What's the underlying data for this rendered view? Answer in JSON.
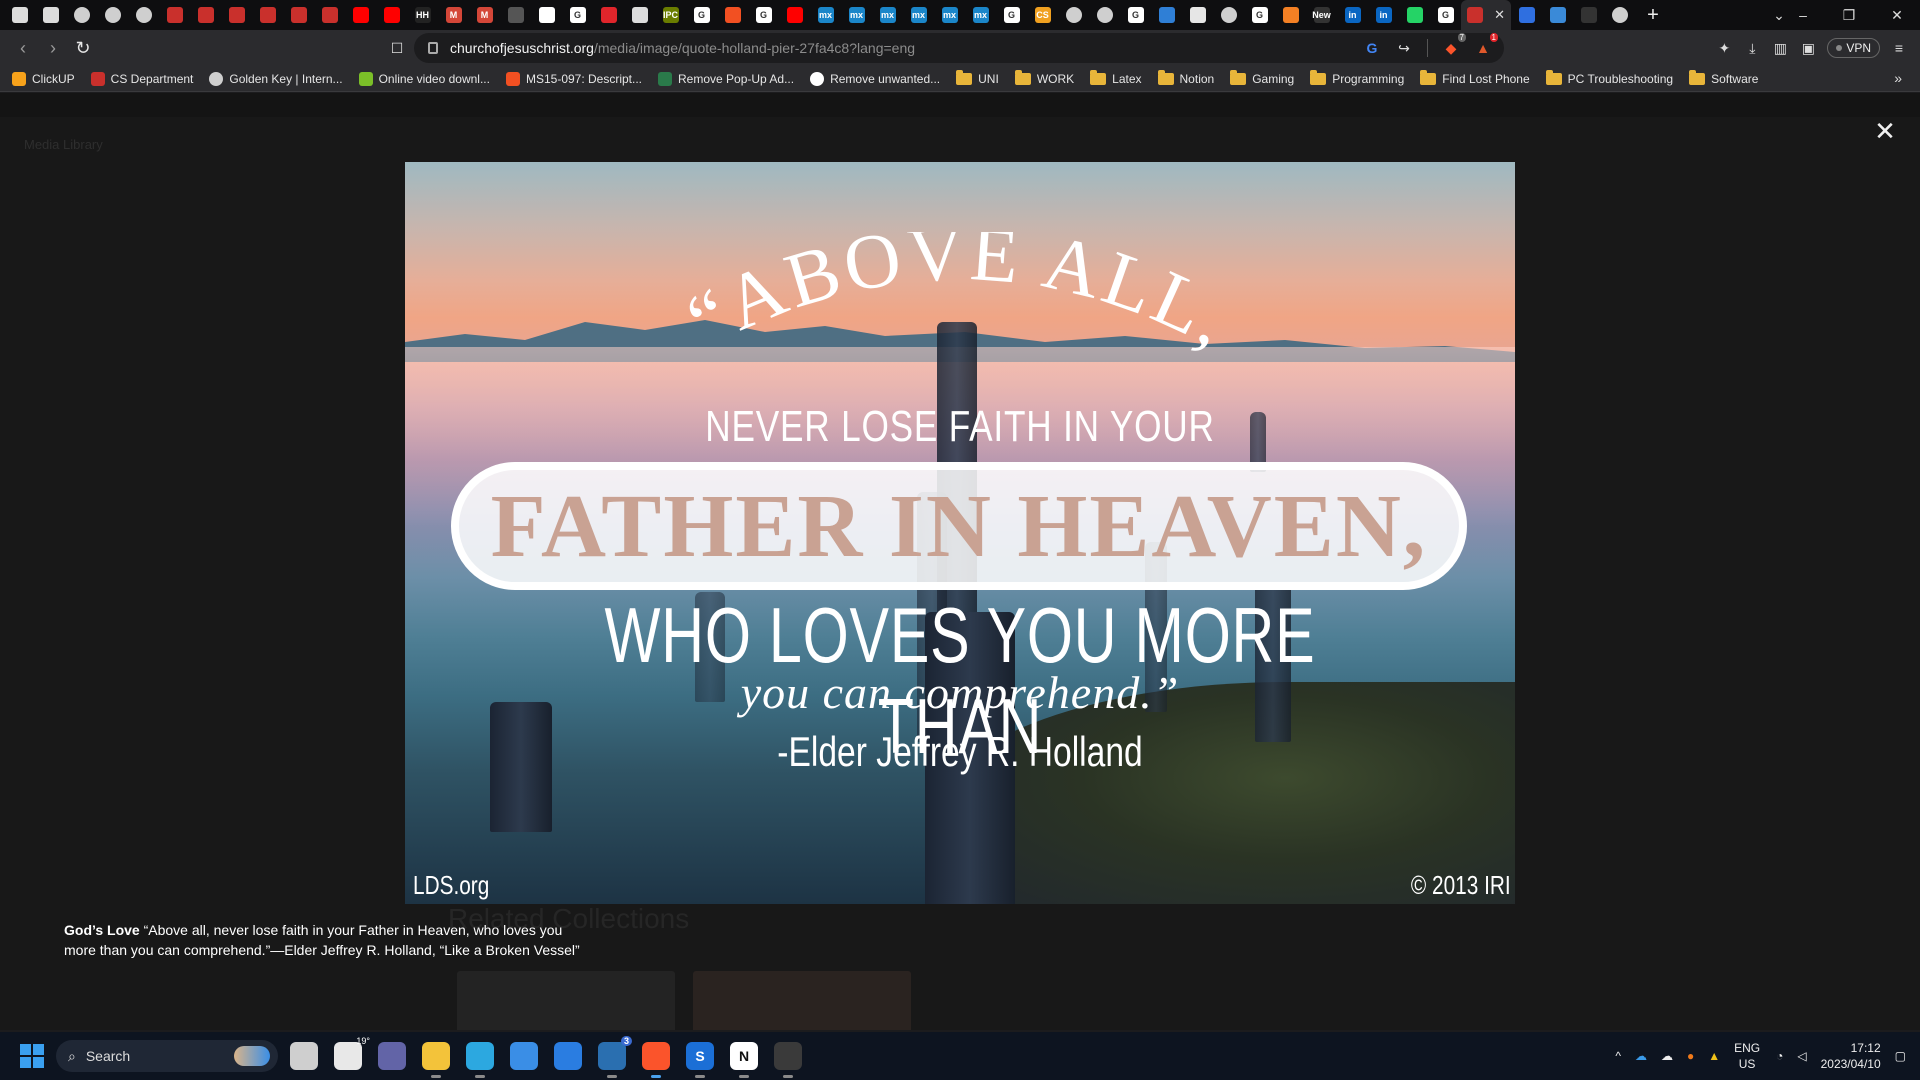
{
  "browser": {
    "tabs": [
      {
        "icon": "page-icon",
        "color": "#dcdcdc"
      },
      {
        "icon": "page-icon",
        "color": "#dcdcdc"
      },
      {
        "icon": "globe-icon",
        "color": "#cfcfcf"
      },
      {
        "icon": "globe-icon",
        "color": "#cfcfcf"
      },
      {
        "icon": "globe-icon",
        "color": "#cfcfcf"
      },
      {
        "icon": "church-icon",
        "color": "#c9302c"
      },
      {
        "icon": "church-icon",
        "color": "#c9302c"
      },
      {
        "icon": "church-icon",
        "color": "#c9302c"
      },
      {
        "icon": "church-icon",
        "color": "#c9302c"
      },
      {
        "icon": "church-icon",
        "color": "#c9302c"
      },
      {
        "icon": "church-icon",
        "color": "#c9302c"
      },
      {
        "icon": "youtube-icon",
        "color": "#ff0000"
      },
      {
        "icon": "youtube-icon",
        "color": "#ff0000"
      },
      {
        "icon": "hh-icon",
        "color": "#222222",
        "label": "HH"
      },
      {
        "icon": "gmail-icon",
        "color": "#d44638",
        "label": "M"
      },
      {
        "icon": "gmail-icon",
        "color": "#d44638",
        "label": "M"
      },
      {
        "icon": "heart-icon",
        "color": "#555555"
      },
      {
        "icon": "flag-icon",
        "color": "#ffffff"
      },
      {
        "icon": "google-icon",
        "color": "#ffffff",
        "label": "G"
      },
      {
        "icon": "red-icon",
        "color": "#e0252b"
      },
      {
        "icon": "download-icon",
        "color": "#dddddd"
      },
      {
        "icon": "ipc-icon",
        "color": "#6a7d00",
        "label": "IPC"
      },
      {
        "icon": "google-icon",
        "color": "#ffffff",
        "label": "G"
      },
      {
        "icon": "microsoft-icon",
        "color": "#f25022"
      },
      {
        "icon": "google-icon",
        "color": "#ffffff",
        "label": "G"
      },
      {
        "icon": "youtube-icon",
        "color": "#ff0000"
      },
      {
        "icon": "mx-icon",
        "color": "#1b86c9",
        "label": "mx"
      },
      {
        "icon": "mx-icon",
        "color": "#1b86c9",
        "label": "mx"
      },
      {
        "icon": "mx-icon",
        "color": "#1b86c9",
        "label": "mx"
      },
      {
        "icon": "mx-icon",
        "color": "#1b86c9",
        "label": "mx"
      },
      {
        "icon": "mx-icon",
        "color": "#1b86c9",
        "label": "mx"
      },
      {
        "icon": "mx-icon",
        "color": "#1b86c9",
        "label": "mx"
      },
      {
        "icon": "google-icon",
        "color": "#ffffff",
        "label": "G"
      },
      {
        "icon": "cs-icon",
        "color": "#f0a020",
        "label": "CS"
      },
      {
        "icon": "globe-icon",
        "color": "#cfcfcf"
      },
      {
        "icon": "globe-icon",
        "color": "#cfcfcf"
      },
      {
        "icon": "google-icon",
        "color": "#ffffff",
        "label": "G"
      },
      {
        "icon": "gear-blue-icon",
        "color": "#2f7fd6"
      },
      {
        "icon": "img-icon",
        "color": "#e6e6e6"
      },
      {
        "icon": "globe-icon",
        "color": "#cfcfcf"
      },
      {
        "icon": "google-icon",
        "color": "#ffffff",
        "label": "G"
      },
      {
        "icon": "flame-icon",
        "color": "#f48024"
      },
      {
        "icon": "new-icon",
        "color": "#333333",
        "label": "New"
      },
      {
        "icon": "linkedin-icon",
        "color": "#0a66c2",
        "label": "in"
      },
      {
        "icon": "linkedin-icon",
        "color": "#0a66c2",
        "label": "in"
      },
      {
        "icon": "whatsapp-icon",
        "color": "#25d366"
      },
      {
        "icon": "google-icon",
        "color": "#ffffff",
        "label": "G"
      }
    ],
    "active_tab_icon": "church-icon",
    "active_tab_close": "✕",
    "trailing_tabs": [
      {
        "icon": "shield-blue-icon",
        "color": "#2f6fe0"
      },
      {
        "icon": "ring-icon",
        "color": "#3a8ad8"
      },
      {
        "icon": "dark-icon",
        "color": "#333333"
      },
      {
        "icon": "globe-icon",
        "color": "#cfcfcf"
      }
    ],
    "new_tab_label": "+",
    "tab_search_label": "⌄",
    "window_controls": {
      "minimize": "–",
      "restore": "❐",
      "close": "✕"
    },
    "address": {
      "domain": "churchofjesuschrist.org",
      "path": "/media/image/quote-holland-pier-27fa4c8?lang=eng"
    },
    "vpn_label": "VPN",
    "brave_badge": "7",
    "alert_badge": "1"
  },
  "bookmarks": [
    {
      "label": "ClickUP",
      "icon": "clickup-icon",
      "color": "#f7a21b"
    },
    {
      "label": "CS Department",
      "icon": "church-icon",
      "color": "#c9302c"
    },
    {
      "label": "Golden Key | Intern...",
      "icon": "globe-icon",
      "color": "#cfcfcf"
    },
    {
      "label": "Online video downl...",
      "icon": "download-arrow-icon",
      "color": "#7bbf28"
    },
    {
      "label": "MS15-097: Descript...",
      "icon": "microsoft-icon",
      "color": "#f25022"
    },
    {
      "label": "Remove Pop-Up Ad...",
      "icon": "bug-icon",
      "color": "#2a7a4a"
    },
    {
      "label": "Remove unwanted...",
      "icon": "google-icon",
      "color": "#ffffff"
    },
    {
      "label": "UNI",
      "icon": "folder-icon"
    },
    {
      "label": "WORK",
      "icon": "folder-icon"
    },
    {
      "label": "Latex",
      "icon": "folder-icon"
    },
    {
      "label": "Notion",
      "icon": "folder-icon"
    },
    {
      "label": "Gaming",
      "icon": "folder-icon"
    },
    {
      "label": "Programming",
      "icon": "folder-icon"
    },
    {
      "label": "Find Lost Phone",
      "icon": "folder-icon"
    },
    {
      "label": "PC Troubleshooting",
      "icon": "folder-icon"
    },
    {
      "label": "Software",
      "icon": "folder-icon"
    }
  ],
  "bookmarks_more": "»",
  "lightbox": {
    "close_label": "✕",
    "image_alt": "Above all, never lose faith in your Father in Heaven quote over a pier at sunset",
    "quote_arc": "“ABOVE ALL,",
    "quote_line1": "NEVER LOSE FAITH IN YOUR",
    "quote_banner": "FATHER IN HEAVEN,",
    "quote_line3": "WHO LOVES YOU MORE THAN",
    "quote_line4": "you can comprehend.”",
    "quote_attribution": "-Elder Jeffrey R. Holland",
    "watermark_left": "LDS.org",
    "watermark_right": "© 2013 IRI",
    "caption_title": "God’s Love",
    "caption_text": " “Above all, never lose faith in your Father in Heaven, who loves you more than you can comprehend.”—Elder Jeffrey R. Holland, “Like a Broken Vessel”"
  },
  "background_page": {
    "heading": "Related Collections",
    "breadcrumb": "Media Library"
  },
  "taskbar": {
    "search_label": "Search",
    "weather_temp": "19°",
    "apps": [
      {
        "name": "task-view-icon",
        "color": "#cfcfcf"
      },
      {
        "name": "weather-icon",
        "color": "#e8e8e8"
      },
      {
        "name": "teams-icon",
        "color": "#6264a7"
      },
      {
        "name": "file-explorer-icon",
        "color": "#f3c33a"
      },
      {
        "name": "edge-icon",
        "color": "#2ca8e0"
      },
      {
        "name": "store-icon",
        "color": "#3a8ee6"
      },
      {
        "name": "mail-icon",
        "color": "#2a7de1"
      },
      {
        "name": "steam-icon",
        "color": "#2a6fb0"
      },
      {
        "name": "brave-icon",
        "color": "#fb542b"
      },
      {
        "name": "s-app-icon",
        "color": "#1b6fd6",
        "label": "S"
      },
      {
        "name": "notion-icon",
        "color": "#ffffff",
        "label": "N"
      },
      {
        "name": "terminal-icon",
        "color": "#3a3a3a"
      }
    ],
    "steam_badge": "3",
    "tray_up": "^",
    "lang_top": "ENG",
    "lang_bottom": "US",
    "time": "17:12",
    "date": "2023/04/10"
  }
}
